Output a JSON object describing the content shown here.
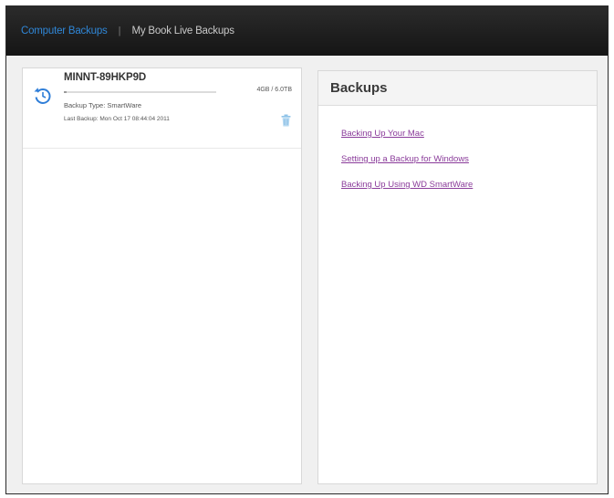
{
  "tabs": [
    {
      "label": "Computer Backups",
      "active": true
    },
    {
      "label": "My Book Live Backups",
      "active": false
    }
  ],
  "separator": "|",
  "backup": {
    "device_name": "MINNT-89HKP9D",
    "size": "4GB / 6.0TB",
    "progress_fraction": 0.02,
    "backup_type": "Backup Type: SmartWare",
    "last_backup": "Last Backup: Mon Oct 17 08:44:04 2011",
    "icon": "history-icon",
    "delete_icon": "trash-icon"
  },
  "help": {
    "title": "Backups",
    "links": [
      {
        "label": "Backing Up Your Mac"
      },
      {
        "label": "Setting up a Backup for Windows"
      },
      {
        "label": "Backing Up Using WD SmartWare"
      }
    ]
  },
  "colors": {
    "active_tab": "#2f86d6",
    "inactive_tab": "#c9c9c9",
    "link": "#8a3b9a",
    "icon_blue": "#2f7ed8",
    "topbar": "#1c1c1c"
  }
}
